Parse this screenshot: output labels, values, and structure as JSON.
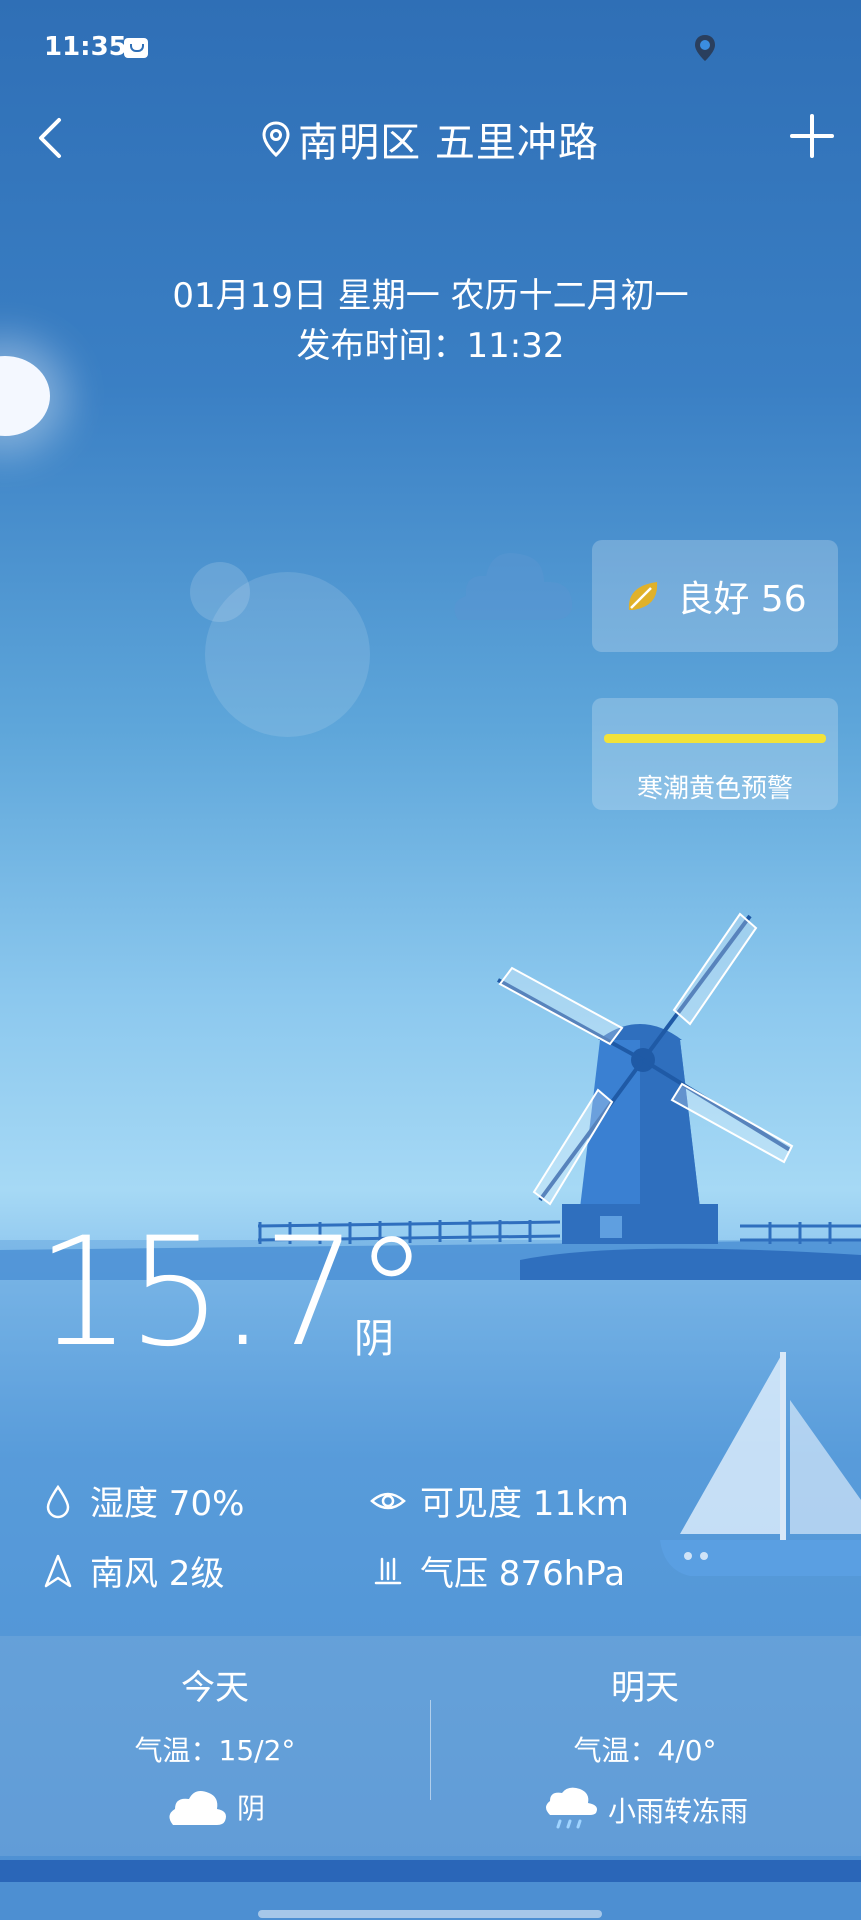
{
  "status_bar": {
    "time": "11:35"
  },
  "header": {
    "location": "南明区 五里冲路"
  },
  "date": {
    "line": "01月19日 星期一 农历十二月初一",
    "release": "发布时间：11:32"
  },
  "aqi": {
    "label": "良好 56"
  },
  "warning": {
    "label": "寒潮黄色预警",
    "color": "#f2e23a"
  },
  "current": {
    "temperature": "15.7°",
    "condition": "阴"
  },
  "details": {
    "humidity": "湿度 70%",
    "visibility": "可见度 11km",
    "wind": "南风 2级",
    "pressure": "气压 876hPa"
  },
  "forecast": [
    {
      "day": "今天",
      "temp": "气温：15/2°",
      "condition": "阴",
      "icon": "cloud-icon"
    },
    {
      "day": "明天",
      "temp": "气温：4/0°",
      "condition": "小雨转冻雨",
      "icon": "rain-cloud-icon"
    }
  ]
}
